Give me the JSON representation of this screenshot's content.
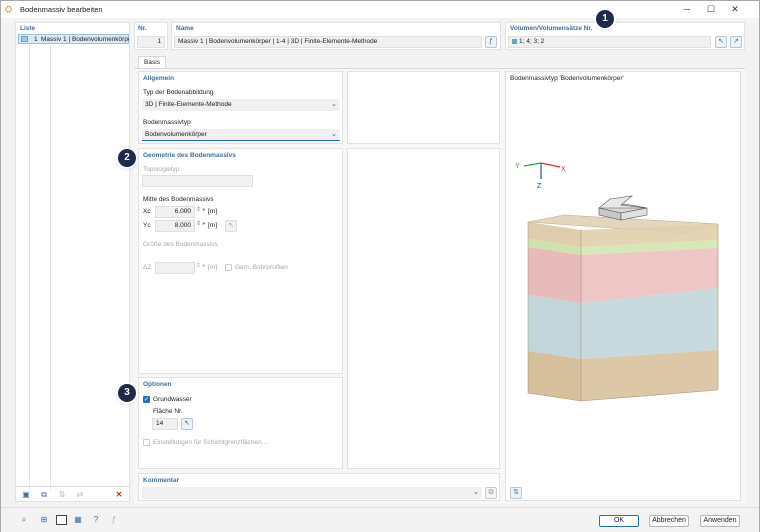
{
  "window": {
    "title": "Bodenmassiv bearbeiten"
  },
  "list": {
    "header": "Liste",
    "items": [
      {
        "number": "1",
        "label": "Massiv 1 | Bodenvolumenkörper"
      }
    ]
  },
  "nr": {
    "label": "Nr.",
    "value": "1"
  },
  "name": {
    "label": "Name",
    "value": "Massiv 1 | Bodenvolumenkörper | 1-4 | 3D | Finite-Elemente-Methode"
  },
  "volumes": {
    "label": "Volumen/Volumensätze Nr.",
    "value": "1; 4; 3; 2"
  },
  "tabs": [
    "Basis"
  ],
  "allgemein": {
    "header": "Allgemein",
    "typ_label": "Typ der Bodenabbildung",
    "typ_value": "3D | Finite-Elemente-Methode",
    "massivtyp_label": "Bodenmassivtyp",
    "massivtyp_value": "Bodenvolumenkörper"
  },
  "geometrie": {
    "header": "Geometrie des Bodenmassivs",
    "topologie_label": "Topologietyp",
    "mitte_label": "Mitte des Bodenmassivs",
    "xc_label": "Xc",
    "xc_value": "6.000",
    "yc_label": "Yc",
    "yc_value": "8.000",
    "unit": "[m]",
    "groesse_label": "Größe des Bodenmassivs",
    "dz_label": "ΔZ",
    "gem_label": "Gem. Bohrprofilen"
  },
  "optionen": {
    "header": "Optionen",
    "grundwasser_label": "Grundwasser",
    "grundwasser_checked": true,
    "flaeche_label": "Fläche Nr.",
    "flaeche_value": "14",
    "einstellungen_label": "Einstellungen für Schichtgrenzflächen..."
  },
  "kommentar": {
    "header": "Kommentar",
    "value": ""
  },
  "preview": {
    "title": "Bodenmassivtyp 'Bodenvolumenkörper'",
    "axis_x": "X",
    "axis_y": "Y",
    "axis_z": "Z"
  },
  "badges": [
    "1",
    "2",
    "3"
  ],
  "buttons": {
    "ok": "OK",
    "cancel": "Abbrechen",
    "apply": "Anwenden"
  },
  "colors": {
    "header_blue": "#3d6ea3",
    "accent": "#1f6fc4",
    "badge": "#1f2a4a",
    "layer_top": "#d9c9a8",
    "layer_green": "#c9e0a8",
    "layer_red": "#e8b8b8",
    "layer_blue": "#bcd2d8",
    "layer_bottom": "#d9c6a2"
  }
}
